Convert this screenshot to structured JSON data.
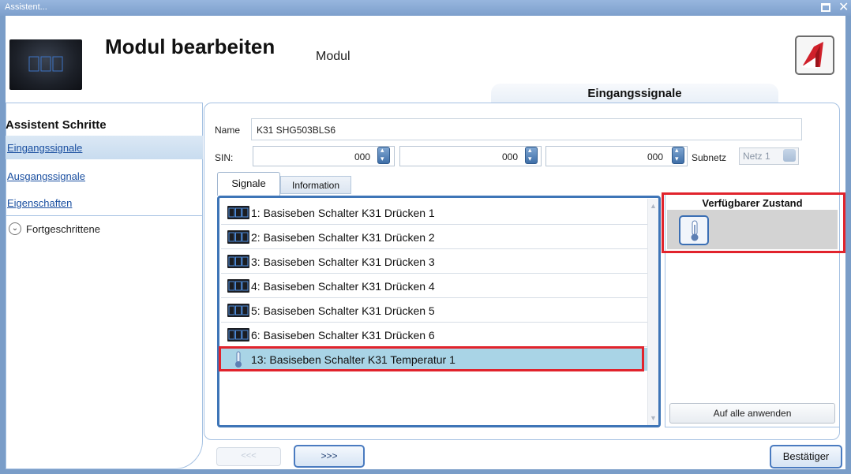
{
  "window": {
    "title": "Assistent..."
  },
  "header": {
    "title": "Modul bearbeiten",
    "subtitle": "Modul",
    "step_tab": "Eingangssignale"
  },
  "steps": {
    "title": "Assistent Schritte",
    "items": [
      {
        "label": "Eingangssignale"
      },
      {
        "label": "Ausgangssignale"
      },
      {
        "label": "Eigenschaften"
      }
    ],
    "advanced": "Fortgeschrittene"
  },
  "form": {
    "name_label": "Name",
    "name_value": "K31 SHG503BLS6",
    "sin_label": "SIN:",
    "sin_values": [
      "000",
      "000",
      "000"
    ],
    "subnet_label": "Subnetz",
    "subnet_value": "Netz 1"
  },
  "tabs": [
    {
      "label": "Signale"
    },
    {
      "label": "Information"
    }
  ],
  "signals": [
    {
      "label": "1: Basiseben Schalter K31 Drücken 1",
      "icon": "switch-module-icon"
    },
    {
      "label": "2: Basiseben Schalter K31 Drücken 2",
      "icon": "switch-module-icon"
    },
    {
      "label": "3: Basiseben Schalter K31 Drücken 3",
      "icon": "switch-module-icon"
    },
    {
      "label": "4: Basiseben Schalter K31 Drücken 4",
      "icon": "switch-module-icon"
    },
    {
      "label": "5: Basiseben Schalter K31 Drücken 5",
      "icon": "switch-module-icon"
    },
    {
      "label": "6: Basiseben Schalter K31 Drücken 6",
      "icon": "switch-module-icon"
    },
    {
      "label": "13: Basiseben Schalter K31 Temperatur 1",
      "icon": "thermometer-icon",
      "selected": true
    }
  ],
  "states": {
    "title": "Verfügbarer Zustand",
    "apply_all": "Auf alle anwenden"
  },
  "footer": {
    "prev": "<<<",
    "next": ">>>",
    "confirm": "Bestätiger"
  },
  "colors": {
    "highlight": "#e1232c",
    "accent": "#3e75b7",
    "selected_row": "#a9d4e6"
  }
}
